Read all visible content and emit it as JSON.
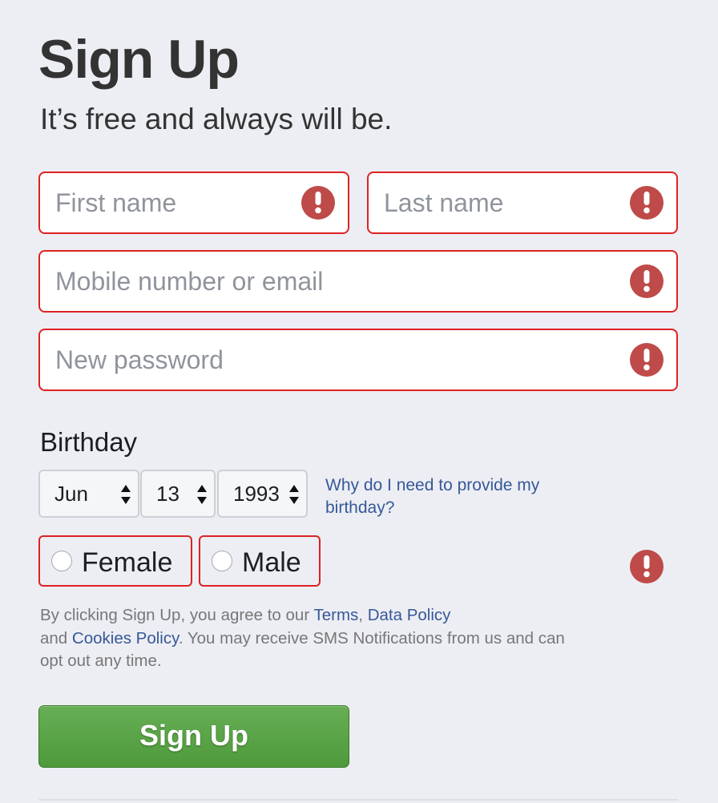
{
  "header": {
    "title": "Sign Up",
    "subtitle": "It’s free and always will be."
  },
  "form": {
    "first_name": {
      "placeholder": "First name",
      "value": ""
    },
    "last_name": {
      "placeholder": "Last name",
      "value": ""
    },
    "contact": {
      "placeholder": "Mobile number or email",
      "value": ""
    },
    "password": {
      "placeholder": "New password",
      "value": ""
    },
    "error_icon": "exclamation-icon"
  },
  "birthday": {
    "label": "Birthday",
    "month": "Jun",
    "day": "13",
    "year": "1993",
    "why_link": "Why do I need to provide my birthday?"
  },
  "gender": {
    "female": "Female",
    "male": "Male"
  },
  "legal": {
    "prefix": "By clicking Sign Up, you agree to our ",
    "terms": "Terms",
    "comma": ", ",
    "data_policy": "Data Policy",
    "and": " and ",
    "cookies_policy": "Cookies Policy",
    "suffix": ". You may receive SMS Notifications from us and can opt out any time."
  },
  "submit": {
    "label": "Sign Up"
  },
  "colors": {
    "error_border": "#dd2222",
    "error_icon": "#be4b49",
    "link": "#365899",
    "button_green": "#5aa447",
    "background": "#edeef3"
  }
}
